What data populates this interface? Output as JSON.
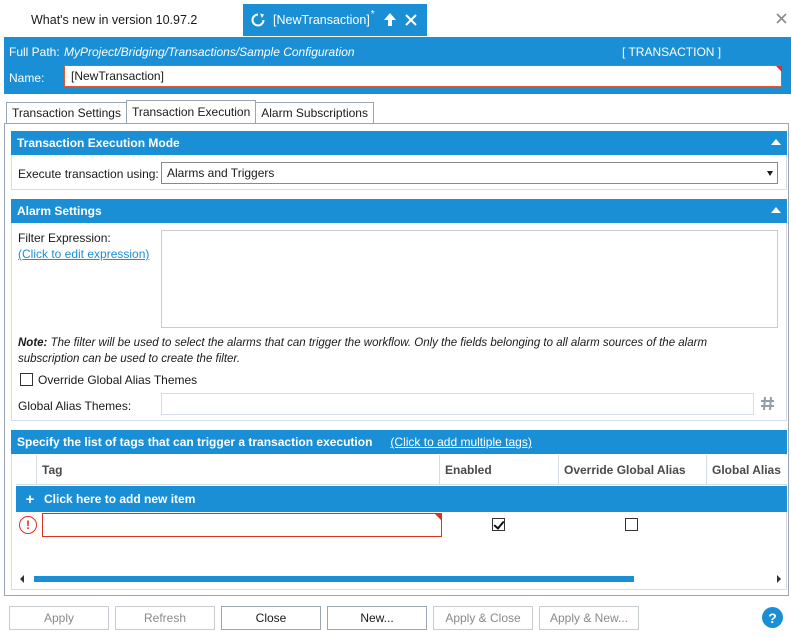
{
  "doc_tabs": [
    {
      "label": "What's new in version 10.97.2",
      "active": false
    },
    {
      "label": "[NewTransaction]",
      "modified_marker": "*",
      "active": true
    }
  ],
  "path_bar": {
    "full_path_label": "Full Path:",
    "full_path_value": "MyProject/Bridging/Transactions/Sample Configuration",
    "type_badge": "[ TRANSACTION ]",
    "name_label": "Name:",
    "name_value": "[NewTransaction]"
  },
  "prop_tabs": [
    {
      "label": "Transaction Settings",
      "selected": false
    },
    {
      "label": "Transaction Execution",
      "selected": true
    },
    {
      "label": "Alarm Subscriptions",
      "selected": false
    }
  ],
  "execution_mode": {
    "title": "Transaction Execution Mode",
    "execute_label": "Execute transaction using:",
    "execute_value": "Alarms and Triggers"
  },
  "alarm_settings": {
    "title": "Alarm Settings",
    "filter_label": "Filter Expression:",
    "filter_link": "(Click to edit expression)",
    "filter_value": "",
    "note_prefix": "Note:",
    "note_line1": " The filter will be used to select the alarms that can trigger the workflow. Only the fields belonging to all alarm sources of the alarm",
    "note_line2": "subscription can be used to create the filter.",
    "override_label": "Override Global Alias Themes",
    "override_checked": false,
    "themes_label": "Global Alias Themes:",
    "themes_value": ""
  },
  "tags_section": {
    "title": "Specify the list of tags that can trigger a transaction execution",
    "add_multiple_link": "(Click to add multiple tags)",
    "columns": [
      "Tag",
      "Enabled",
      "Override Global Alias",
      "Global Alias"
    ],
    "add_row_label": "Click here to add new item",
    "rows": [
      {
        "tag": "",
        "enabled": true,
        "override": false,
        "invalid": true
      }
    ]
  },
  "buttons": {
    "apply": "Apply",
    "refresh": "Refresh",
    "close": "Close",
    "new": "New...",
    "apply_close": "Apply & Close",
    "apply_new": "Apply & New...",
    "help": "?"
  },
  "colors": {
    "accent": "#1a8fd6",
    "error": "#d9331f"
  }
}
